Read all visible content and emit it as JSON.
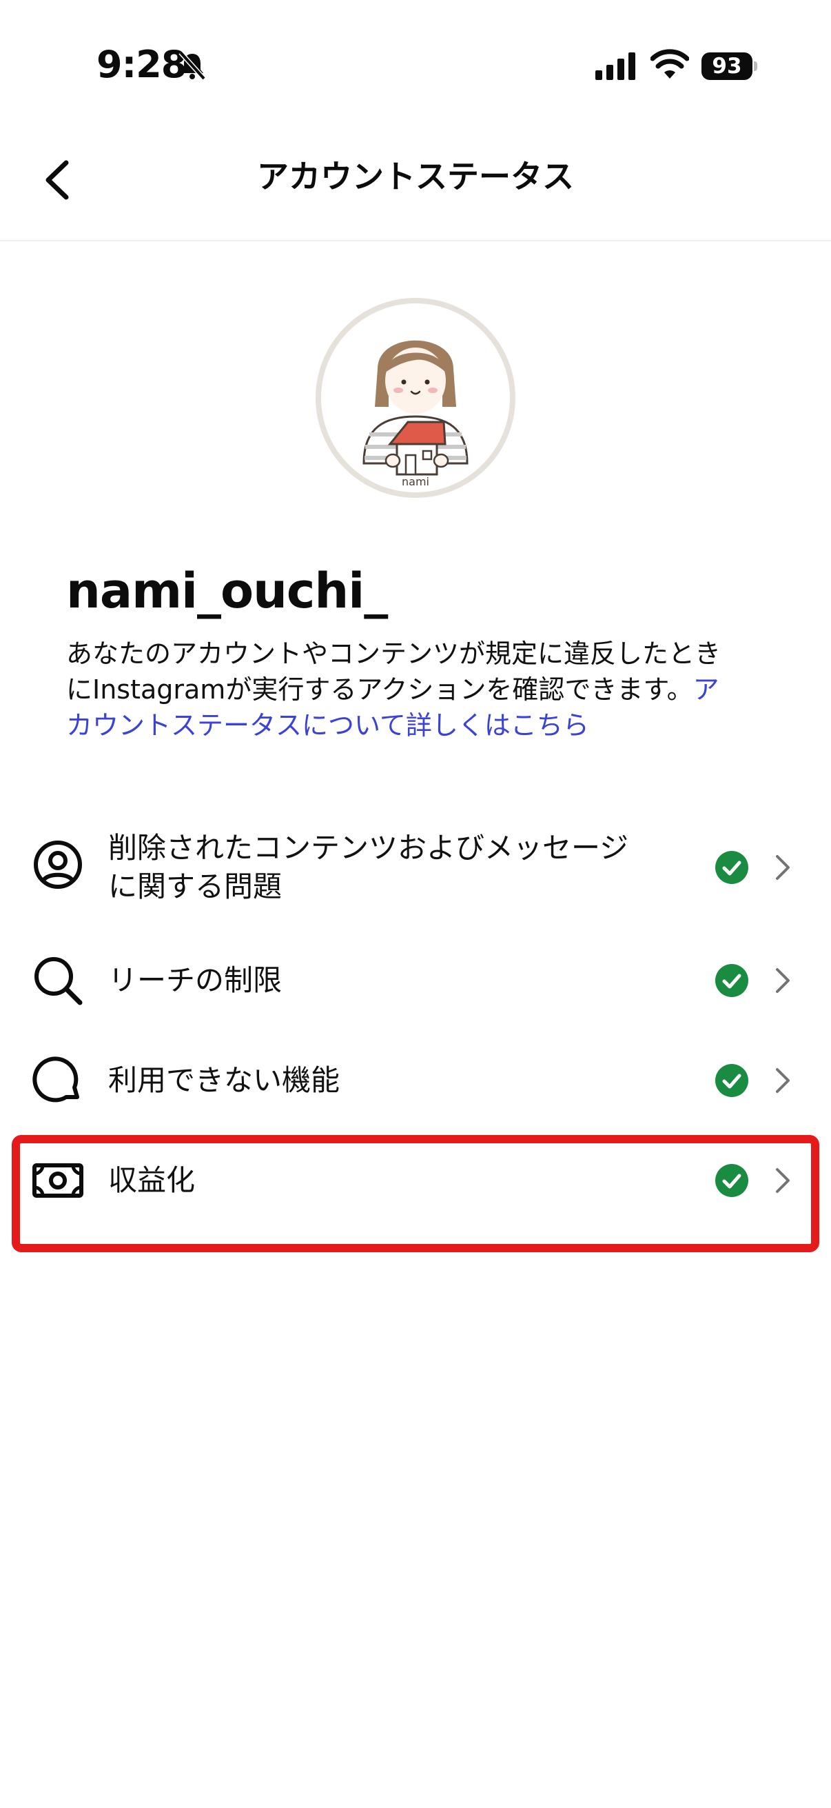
{
  "status_bar": {
    "time": "9:28",
    "battery_percent": "93"
  },
  "header": {
    "title": "アカウントステータス"
  },
  "profile": {
    "username": "nami_ouchi_",
    "avatar_caption": "nami",
    "description_line1": "あなたのアカウントやコンテンツが規定に違反したとき",
    "description_line2": "にInstagramが実行するアクションを確認できます。",
    "description_link_part1": "ア",
    "description_link_part2": "カウントステータスについて詳しくはこちら"
  },
  "status_items": [
    {
      "label_line1": "削除されたコンテンツおよびメッセージ",
      "label_line2": "に関する問題",
      "icon": "user-circle-icon",
      "status": "ok"
    },
    {
      "label": "リーチの制限",
      "icon": "search-icon",
      "status": "ok"
    },
    {
      "label": "利用できない機能",
      "icon": "chat-bubble-icon",
      "status": "ok"
    },
    {
      "label": "収益化",
      "icon": "money-icon",
      "status": "ok"
    }
  ],
  "colors": {
    "accent_link": "#3b42d8",
    "ok_green": "#1a8c42",
    "highlight_red": "#e51a1a"
  }
}
